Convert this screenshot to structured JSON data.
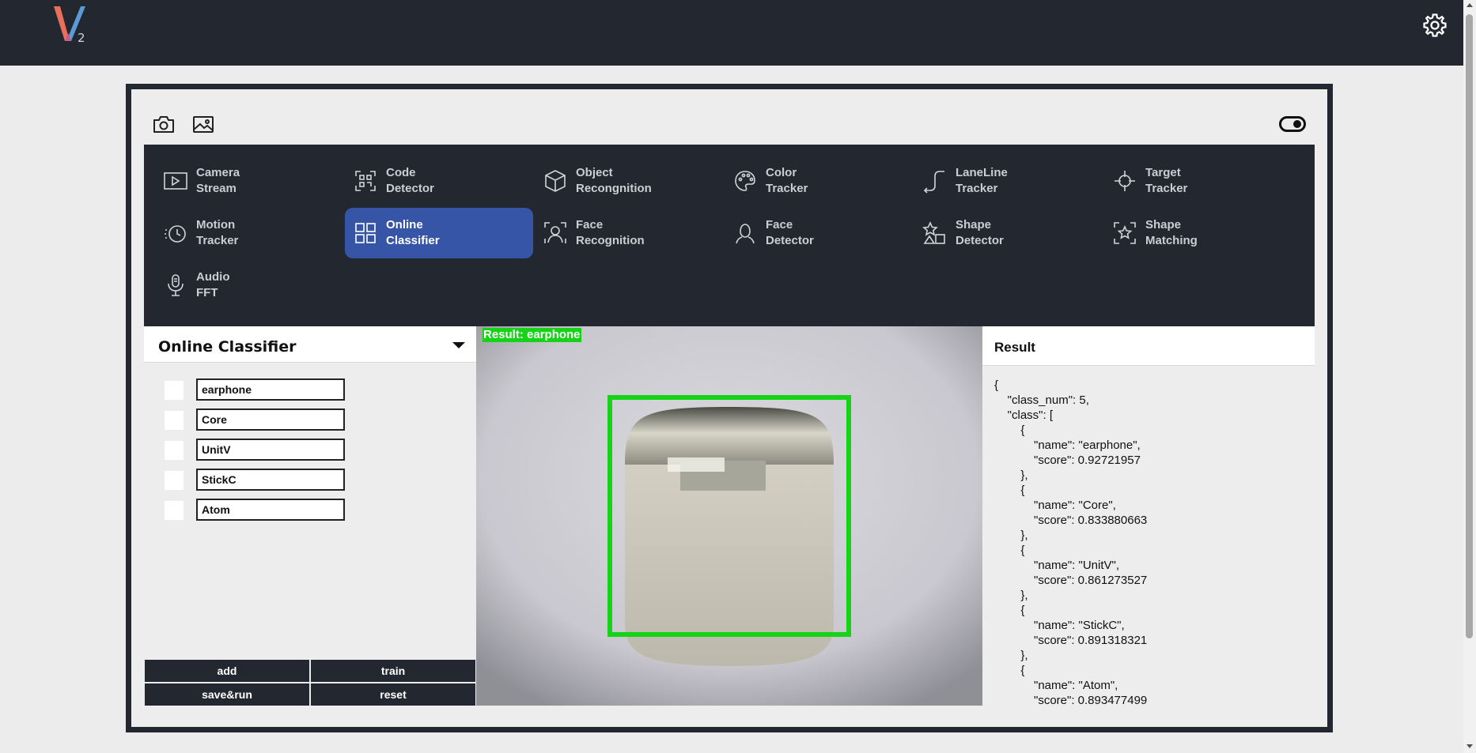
{
  "app": {
    "logo_sub": "2"
  },
  "menu": {
    "items": [
      {
        "line1": "Camera",
        "line2": "Stream",
        "icon": "play-icon",
        "active": false
      },
      {
        "line1": "Code",
        "line2": "Detector",
        "icon": "qr-icon",
        "active": false
      },
      {
        "line1": "Object",
        "line2": "Recongnition",
        "icon": "cube-icon",
        "active": false
      },
      {
        "line1": "Color",
        "line2": "Tracker",
        "icon": "palette-icon",
        "active": false
      },
      {
        "line1": "LaneLine",
        "line2": "Tracker",
        "icon": "lane-icon",
        "active": false
      },
      {
        "line1": "Target",
        "line2": "Tracker",
        "icon": "crosshair-icon",
        "active": false
      },
      {
        "line1": "Motion",
        "line2": "Tracker",
        "icon": "motion-icon",
        "active": false
      },
      {
        "line1": "Online",
        "line2": "Classifier",
        "icon": "grid-icon",
        "active": true
      },
      {
        "line1": "Face",
        "line2": "Recognition",
        "icon": "face-scan-icon",
        "active": false
      },
      {
        "line1": "Face",
        "line2": "Detector",
        "icon": "face-icon",
        "active": false
      },
      {
        "line1": "Shape",
        "line2": "Detector",
        "icon": "shapes-icon",
        "active": false
      },
      {
        "line1": "Shape",
        "line2": "Matching",
        "icon": "shape-match-icon",
        "active": false
      },
      {
        "line1": "Audio",
        "line2": "FFT",
        "icon": "mic-icon",
        "active": false
      }
    ]
  },
  "classifier": {
    "title": "Online Classifier",
    "classes": [
      "earphone",
      "Core",
      "UnitV",
      "StickC",
      "Atom"
    ],
    "buttons": {
      "add": "add",
      "train": "train",
      "save_run": "save&run",
      "reset": "reset"
    }
  },
  "view": {
    "result_label": "Result: earphone"
  },
  "result": {
    "title": "Result",
    "json_lines": [
      "{",
      "    \"class_num\": 5,",
      "    \"class\": [",
      "        {",
      "            \"name\": \"earphone\",",
      "            \"score\": 0.92721957",
      "        },",
      "        {",
      "            \"name\": \"Core\",",
      "            \"score\": 0.833880663",
      "        },",
      "        {",
      "            \"name\": \"UnitV\",",
      "            \"score\": 0.861273527",
      "        },",
      "        {",
      "            \"name\": \"StickC\",",
      "            \"score\": 0.891318321",
      "        },",
      "        {",
      "            \"name\": \"Atom\",",
      "            \"score\": 0.893477499"
    ]
  },
  "colors": {
    "dark": "#232830",
    "accent": "#3655a6",
    "detect_green": "#17d317"
  }
}
